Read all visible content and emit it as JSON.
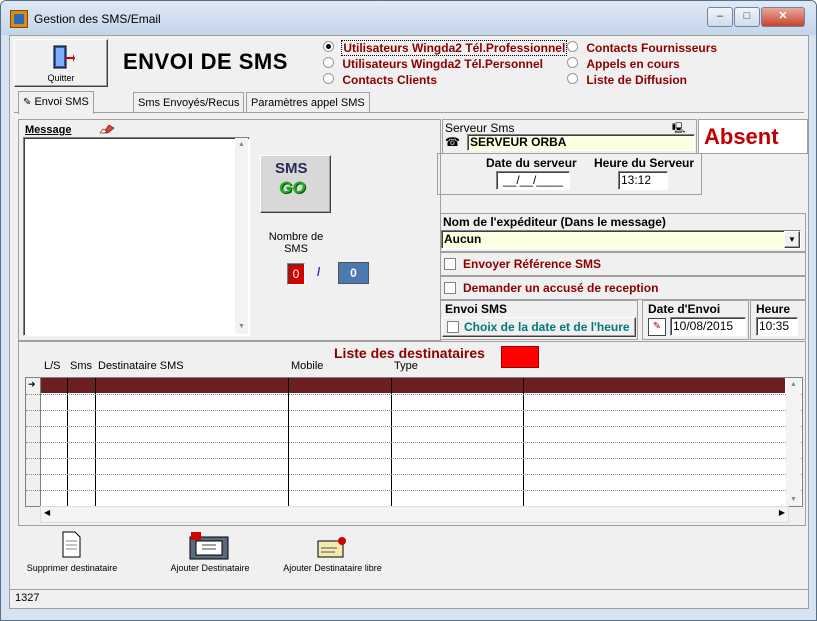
{
  "window": {
    "title": "Gestion des SMS/Email",
    "controls": {
      "minimize": "‒",
      "maximize": "□",
      "close": "✕"
    }
  },
  "header": {
    "quit_label": "Quitter",
    "page_title": "ENVOI DE SMS"
  },
  "recipient_types": [
    {
      "label": "Utilisateurs Wingda2 Tél.Professionnel",
      "selected": true
    },
    {
      "label": "Utilisateurs Wingda2 Tél.Personnel",
      "selected": false
    },
    {
      "label": "Contacts Clients",
      "selected": false
    },
    {
      "label": "Contacts Fournisseurs",
      "selected": false
    },
    {
      "label": "Appels en cours",
      "selected": false
    },
    {
      "label": "Liste de Diffusion",
      "selected": false
    }
  ],
  "tabs": [
    "Envoi SMS",
    "Sms Envoyés/Recus",
    "Paramètres appel SMS"
  ],
  "message": {
    "label": "Message",
    "text": ""
  },
  "sms_button": {
    "top": "SMS",
    "bottom": "GO"
  },
  "count": {
    "label": "Nombre de SMS",
    "value": "0",
    "separator": "/",
    "total": "0"
  },
  "server": {
    "label": "Serveur Sms",
    "name": "SERVEUR ORBA",
    "status": "Absent",
    "date_label": "Date du serveur",
    "date_value": "__/__/____",
    "time_label": "Heure du Serveur",
    "time_value": "13:12"
  },
  "sender": {
    "label": "Nom de l'expéditeur (Dans le message)",
    "value": "Aucun"
  },
  "options": {
    "reference": "Envoyer Référence SMS",
    "receipt": "Demander un accusé de reception"
  },
  "send": {
    "label": "Envoi SMS",
    "choose": "Choix de la date et de l'heure",
    "date_label": "Date d'Envoi",
    "date_value": "10/08/2015",
    "time_label": "Heure",
    "time_value": "10:35"
  },
  "recipients": {
    "title": "Liste des destinataires",
    "columns": [
      "L/S",
      "Sms",
      "Destinataire SMS",
      "Mobile",
      "Type"
    ],
    "rows": []
  },
  "actions": {
    "delete": "Supprimer destinataire",
    "add": "Ajouter Destinataire",
    "add_free": "Ajouter Destinataire libre"
  },
  "status_bar": {
    "text": "1327"
  },
  "colors": {
    "accent_red": "#d40000",
    "status_absent": "#c00000",
    "highlight_row": "#6b1f1f",
    "field_yellow": "#ffffe1"
  }
}
